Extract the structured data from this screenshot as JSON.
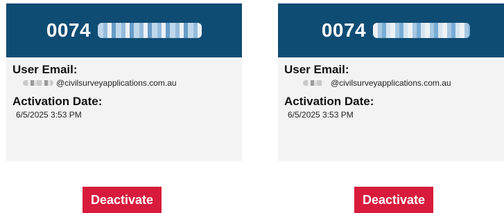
{
  "colors": {
    "header": "#0f4c73",
    "card_bg": "#f3f3f3",
    "button": "#d81b3c"
  },
  "cards": [
    {
      "code_prefix": "0074",
      "email_label": "User Email:",
      "email_value": "@civilsurveyapplications.com.au",
      "date_label": "Activation Date:",
      "date_value": "6/5/2025 3:53 PM",
      "button_label": "Deactivate"
    },
    {
      "code_prefix": "0074",
      "email_label": "User Email:",
      "email_value": "@civilsurveyapplications.com.au",
      "date_label": "Activation Date:",
      "date_value": "6/5/2025 3:53 PM",
      "button_label": "Deactivate"
    }
  ]
}
